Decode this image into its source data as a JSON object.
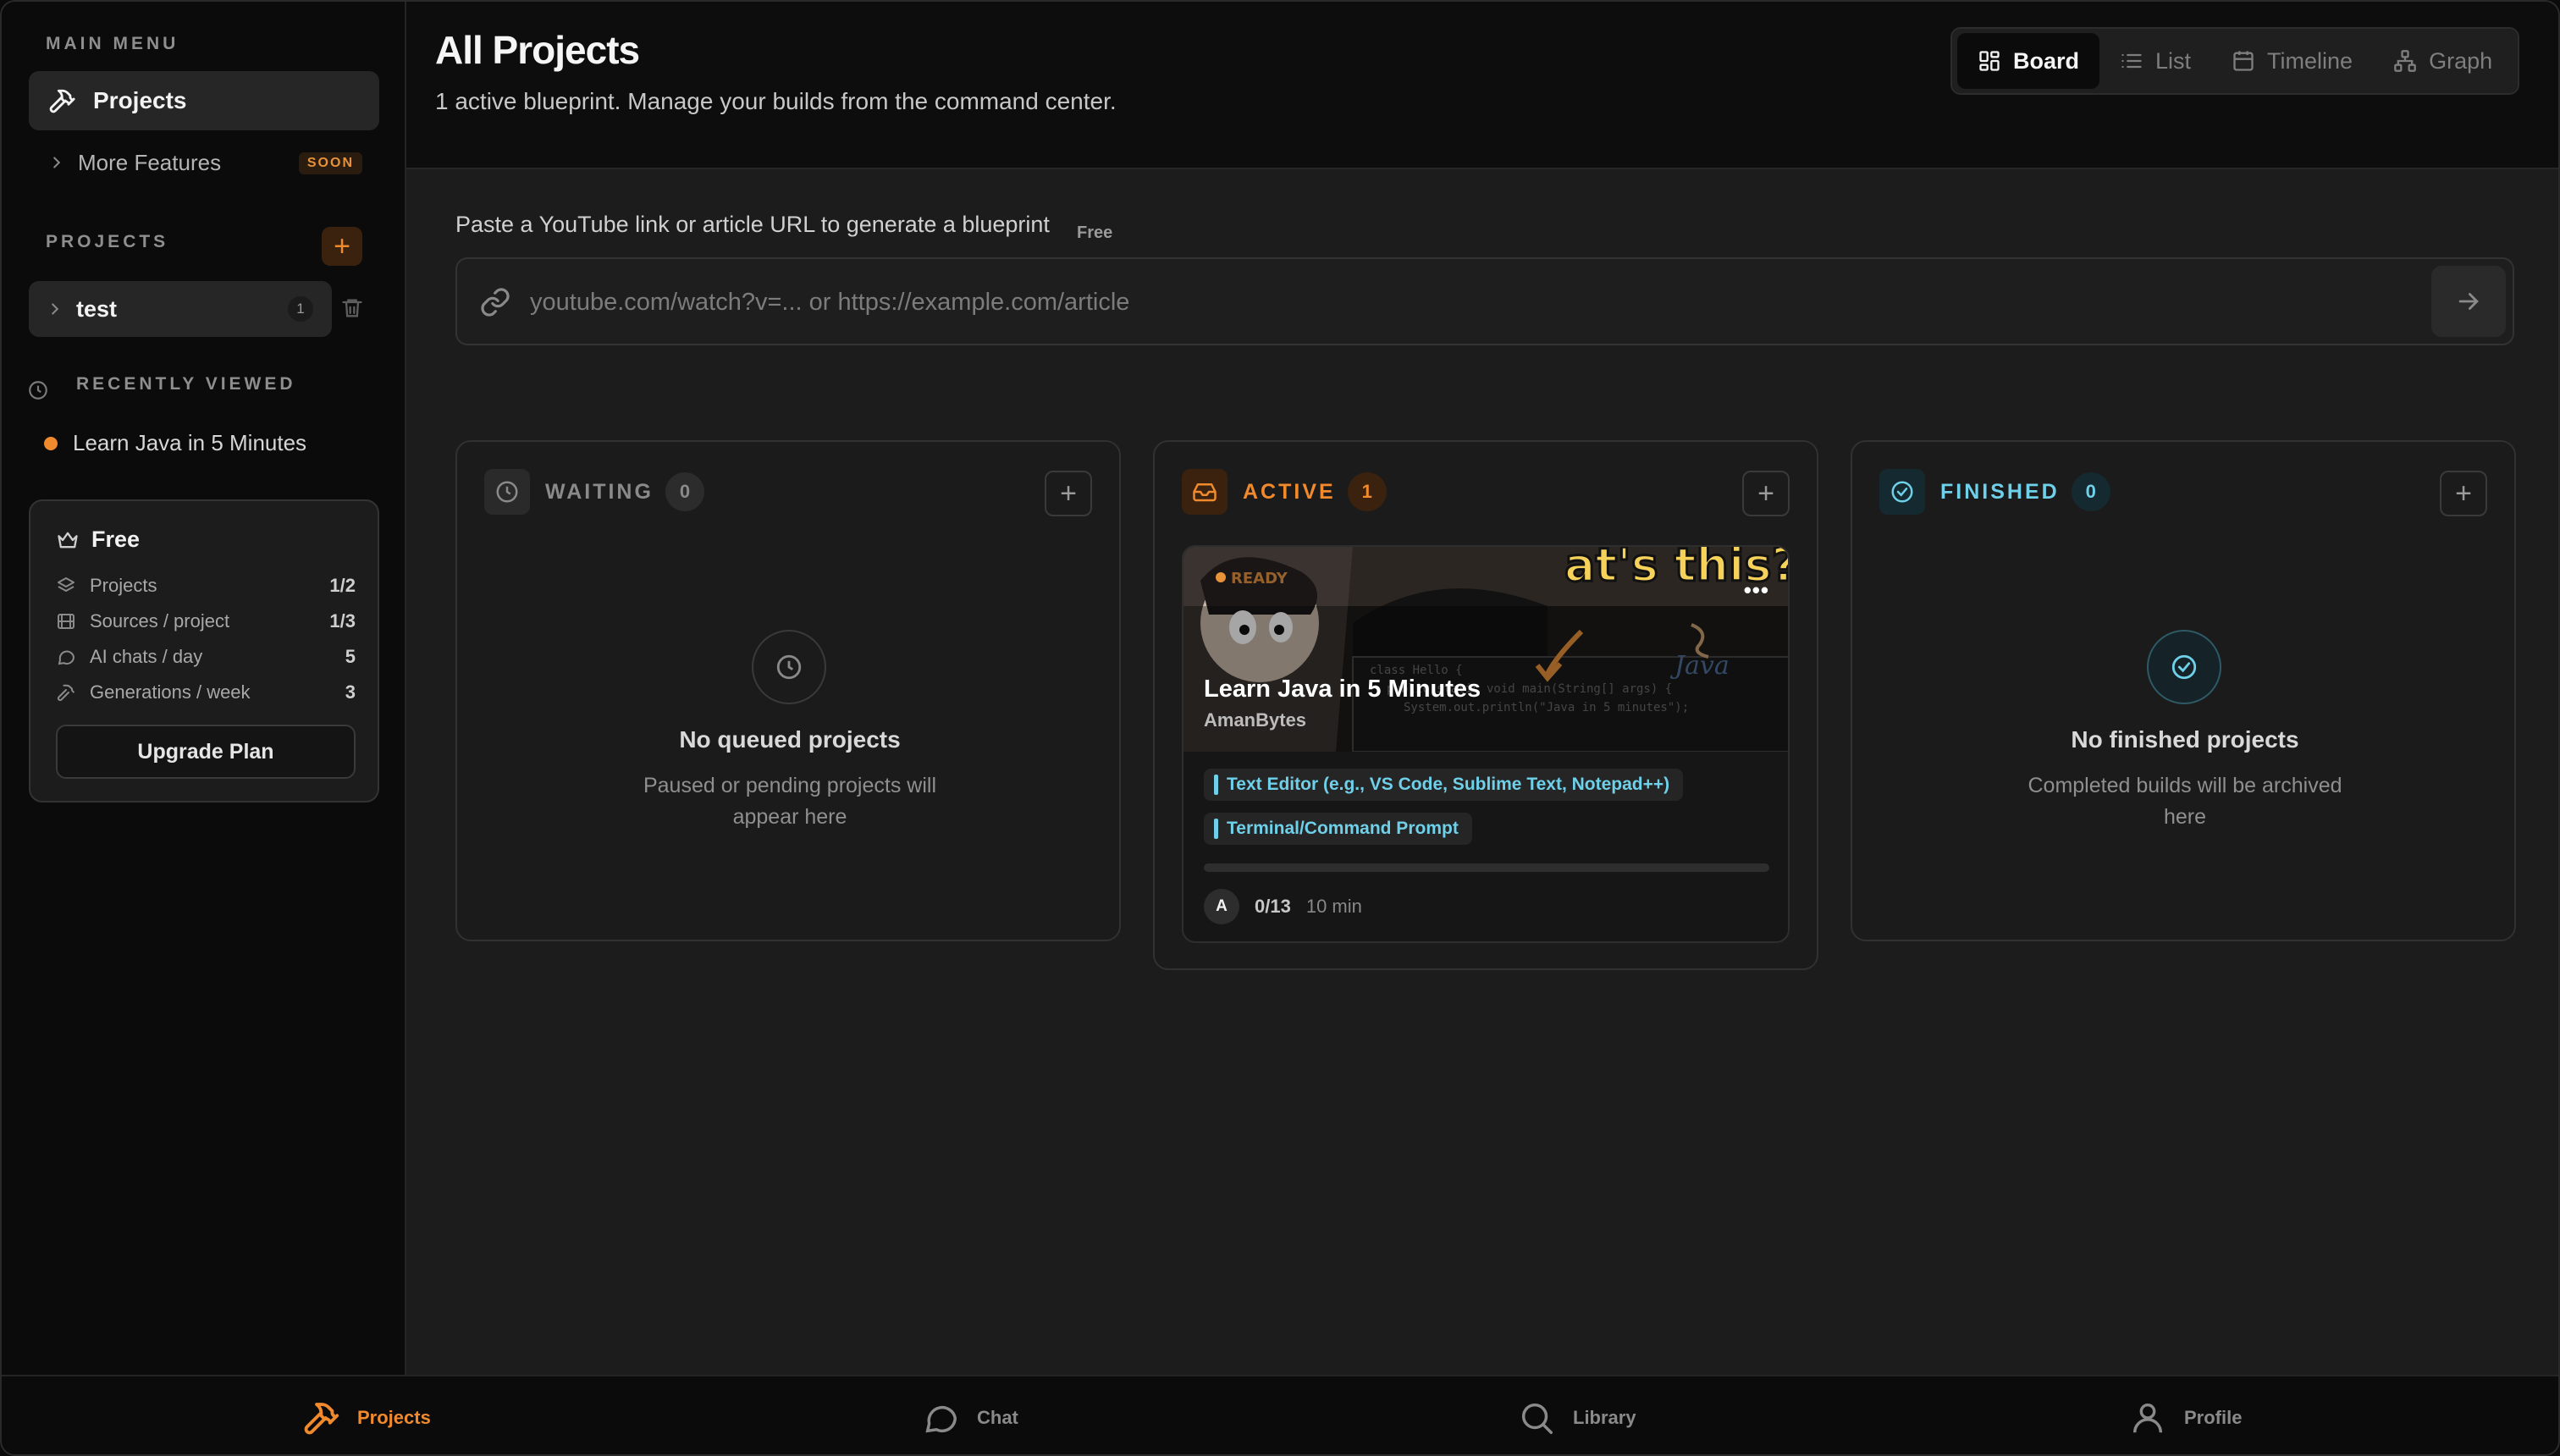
{
  "sidebar": {
    "main_menu_label": "MAIN MENU",
    "nav_projects_label": "Projects",
    "nav_more_label": "More Features",
    "soon_badge": "SOON",
    "projects_section_label": "PROJECTS",
    "add_project_label": "+",
    "project": {
      "name": "test",
      "count": "1"
    },
    "recently_viewed_label": "RECENTLY VIEWED",
    "recent_item": "Learn Java in 5 Minutes",
    "plan": {
      "name": "Free",
      "rows": [
        {
          "label": "Projects",
          "value": "1/2",
          "icon": "layers-icon"
        },
        {
          "label": "Sources / project",
          "value": "1/3",
          "icon": "film-icon"
        },
        {
          "label": "AI chats / day",
          "value": "5",
          "icon": "chat-icon"
        },
        {
          "label": "Generations / week",
          "value": "3",
          "icon": "hammer-icon"
        }
      ],
      "upgrade_label": "Upgrade Plan"
    }
  },
  "header": {
    "title": "All Projects",
    "subtitle": "1 active blueprint. Manage your builds from the command center.",
    "views": [
      {
        "label": "Board",
        "icon": "grid-icon",
        "active": true
      },
      {
        "label": "List",
        "icon": "list-icon",
        "active": false
      },
      {
        "label": "Timeline",
        "icon": "calendar-icon",
        "active": false
      },
      {
        "label": "Graph",
        "icon": "graph-icon",
        "active": false
      }
    ]
  },
  "url_bar": {
    "label": "Paste a YouTube link or article URL to generate a blueprint",
    "free_tag": "Free",
    "placeholder": "youtube.com/watch?v=... or https://example.com/article",
    "value": ""
  },
  "board": {
    "waiting": {
      "title": "WAITING",
      "count": "0",
      "empty_title": "No queued projects",
      "empty_text": "Paused or pending projects will appear here"
    },
    "active": {
      "title": "ACTIVE",
      "count": "1",
      "card": {
        "title": "Learn Java in 5 Minutes",
        "author": "AmanBytes",
        "more": "•••",
        "tags": [
          "Text Editor (e.g., VS Code, Sublime Text, Notepad++)",
          "Terminal/Command Prompt"
        ],
        "progress": 0,
        "avatar_initial": "A",
        "steps": "0/13",
        "duration": "10 min"
      }
    },
    "finished": {
      "title": "FINISHED",
      "count": "0",
      "empty_title": "No finished projects",
      "empty_text": "Completed builds will be archived here"
    }
  },
  "bottom_nav": [
    {
      "label": "Projects",
      "icon": "hammer-icon",
      "active": true
    },
    {
      "label": "Chat",
      "icon": "chat-icon",
      "active": false
    },
    {
      "label": "Library",
      "icon": "search-icon",
      "active": false
    },
    {
      "label": "Profile",
      "icon": "user-icon",
      "active": false
    }
  ],
  "colors": {
    "accent": "#f08a2c",
    "info": "#6fd0ea",
    "background": "#1c1c1c",
    "sidebar": "#0b0b0b"
  }
}
